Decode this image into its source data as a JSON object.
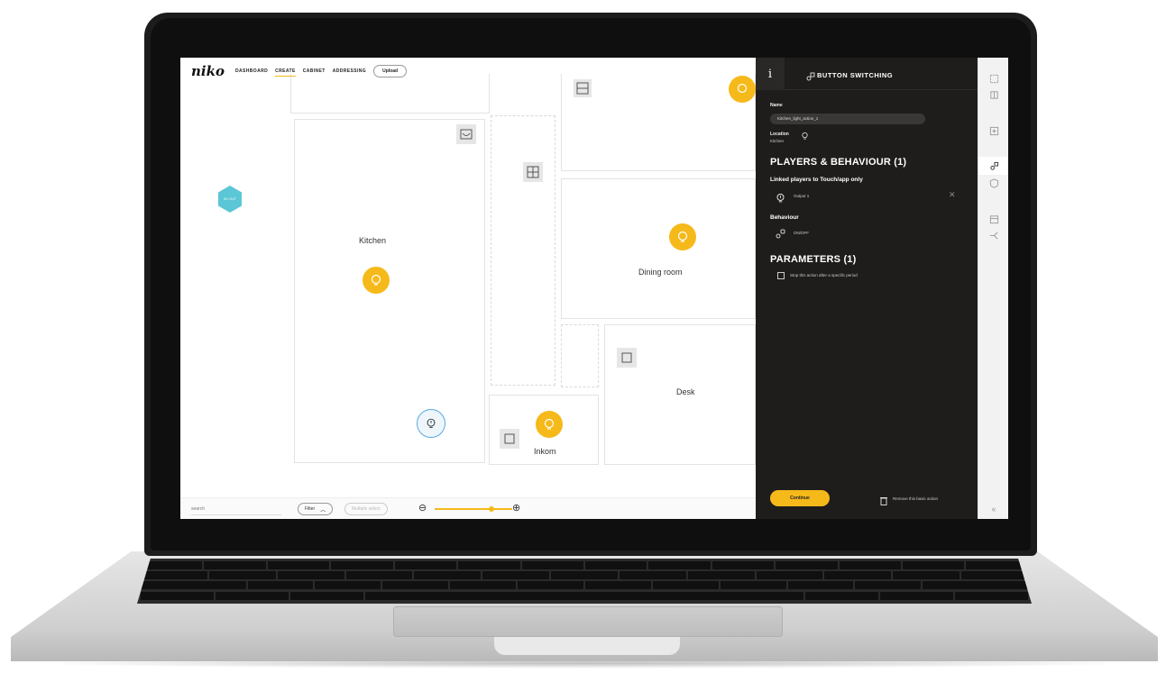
{
  "app": {
    "logo": "niko",
    "nav": [
      {
        "label": "DASHBOARD",
        "active": false
      },
      {
        "label": "CREATE",
        "active": true
      },
      {
        "label": "CABINET",
        "active": false
      },
      {
        "label": "ADDRESSING",
        "active": false
      }
    ],
    "upload_label": "Upload",
    "accent": "#f6b91a"
  },
  "floorplan": {
    "rooms": [
      {
        "name": "Kitchen"
      },
      {
        "name": "Dining room"
      },
      {
        "name": "Desk"
      },
      {
        "name": "Inkom"
      }
    ],
    "hex_label": "IN / OUT"
  },
  "bottombar": {
    "search_placeholder": "search",
    "filter_label": "Filter",
    "multiple_select_label": "Multiple select"
  },
  "panel": {
    "info_icon": "i",
    "title": "BUTTON SWITCHING",
    "name_label": "Name",
    "name_value": "Kitchen_light_action_1",
    "location_label": "Location",
    "location_value": "Kitchen",
    "players_heading": "PLAYERS & BEHAVIOUR (1)",
    "linked_label": "Linked players to Touch/app only",
    "output_label": "Output 1",
    "behaviour_label": "Behaviour",
    "behaviour_value": "ON/OFF",
    "params_heading": "PARAMETERS (1)",
    "param_option": "Stop this action after a specific period",
    "continue_label": "Continue",
    "remove_label": "Remove this basic action"
  }
}
